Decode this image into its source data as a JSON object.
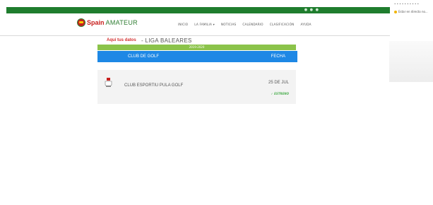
{
  "topbar": {
    "social_icons": "● ● ●"
  },
  "side_panel": {
    "line1": "• • • • • • • • • •",
    "line2": "Estar en directo no..."
  },
  "logo": {
    "word1": "Spain",
    "word2": "AMATEUR"
  },
  "nav": [
    "INICIO",
    "LA FAMILIA ▾",
    "NOTICIAS",
    "CALENDARIO",
    "CLASIFICACIÓN",
    "AYUDA"
  ],
  "main": {
    "my_data_link": "Aquí tus datos",
    "league_title": "- LIGA BALEARES",
    "season": "2019-2020",
    "table": {
      "col_club": "CLUB DE GOLF",
      "col_date": "FECHA",
      "rows": [
        {
          "club": "CLUB ESPORTIU PULA GOLF",
          "date": "25 DE JUL",
          "badge": "✓ ESTRENO"
        }
      ]
    }
  }
}
